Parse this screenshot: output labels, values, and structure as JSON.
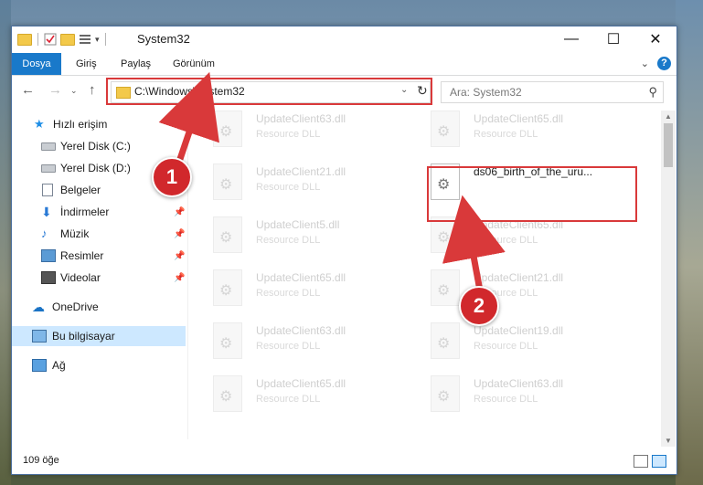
{
  "window": {
    "title": "System32"
  },
  "ribbon": {
    "tabs": [
      "Dosya",
      "Giriş",
      "Paylaş",
      "Görünüm"
    ]
  },
  "address": {
    "path": "C:\\Windows\\System32"
  },
  "search": {
    "placeholder": "Ara: System32"
  },
  "sidebar": {
    "items": [
      {
        "label": "Hızlı erişim",
        "icon": "star-icon"
      },
      {
        "label": "Yerel Disk (C:)",
        "icon": "drive-icon"
      },
      {
        "label": "Yerel Disk (D:)",
        "icon": "drive-icon"
      },
      {
        "label": "Belgeler",
        "icon": "document-icon"
      },
      {
        "label": "İndirmeler",
        "icon": "download-icon",
        "pinned": true
      },
      {
        "label": "Müzik",
        "icon": "music-icon",
        "pinned": true
      },
      {
        "label": "Resimler",
        "icon": "pictures-icon",
        "pinned": true
      },
      {
        "label": "Videolar",
        "icon": "video-icon",
        "pinned": true
      },
      {
        "label": "OneDrive",
        "icon": "cloud-icon"
      },
      {
        "label": "Bu bilgisayar",
        "icon": "computer-icon",
        "selected": true
      },
      {
        "label": "Ağ",
        "icon": "network-icon"
      }
    ]
  },
  "files": [
    {
      "name": "UpdateClient63.dll",
      "type": "Resource DLL"
    },
    {
      "name": "UpdateClient65.dll",
      "type": "Resource DLL"
    },
    {
      "name": "UpdateClient21.dll",
      "type": "Resource DLL"
    },
    {
      "name": "ds06_birth_of_the_uru...",
      "type": "",
      "active": true
    },
    {
      "name": "UpdateClient5.dll",
      "type": "Resource DLL"
    },
    {
      "name": "UpdateClient65.dll",
      "type": "Resource DLL"
    },
    {
      "name": "UpdateClient65.dll",
      "type": "Resource DLL"
    },
    {
      "name": "UpdateClient21.dll",
      "type": "Resource DLL"
    },
    {
      "name": "UpdateClient63.dll",
      "type": "Resource DLL"
    },
    {
      "name": "UpdateClient19.dll",
      "type": "Resource DLL"
    },
    {
      "name": "UpdateClient65.dll",
      "type": "Resource DLL"
    },
    {
      "name": "UpdateClient63.dll",
      "type": "Resource DLL"
    }
  ],
  "status": {
    "count": "109 öğe"
  },
  "annotations": {
    "step1": "1",
    "step2": "2",
    "color": "#d9393a"
  }
}
